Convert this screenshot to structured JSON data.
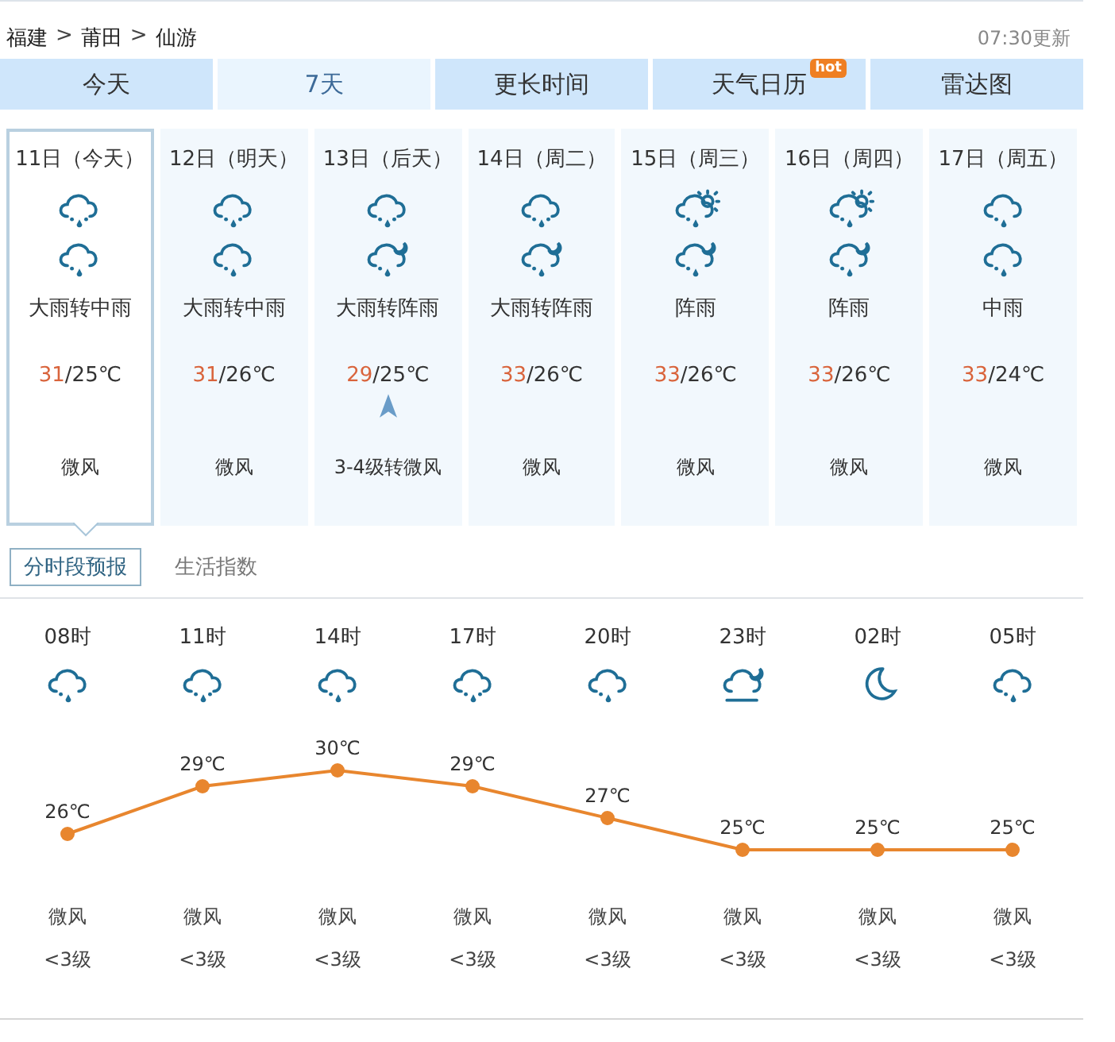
{
  "breadcrumb": [
    {
      "label": "福建"
    },
    {
      "label": "莆田"
    },
    {
      "label": "仙游"
    }
  ],
  "breadcrumb_separator": ">",
  "updated": "07:30更新",
  "tabs": [
    {
      "label": "今天",
      "selected": false
    },
    {
      "label": "7天",
      "selected": true
    },
    {
      "label": "更长时间",
      "selected": false
    },
    {
      "label": "天气日历",
      "selected": false,
      "badge": "hot"
    },
    {
      "label": "雷达图",
      "selected": false
    }
  ],
  "days": [
    {
      "date": "11日（今天）",
      "selected": true,
      "icons": [
        {
          "kind": "heavy-rain"
        },
        {
          "kind": "rain"
        }
      ],
      "weather": "大雨转中雨",
      "high": "31",
      "low": "/25℃",
      "wind_arrow": false,
      "wind": "微风"
    },
    {
      "date": "12日（明天）",
      "selected": false,
      "icons": [
        {
          "kind": "heavy-rain"
        },
        {
          "kind": "rain"
        }
      ],
      "weather": "大雨转中雨",
      "high": "31",
      "low": "/26℃",
      "wind_arrow": false,
      "wind": "微风"
    },
    {
      "date": "13日（后天）",
      "selected": false,
      "icons": [
        {
          "kind": "heavy-rain"
        },
        {
          "kind": "shower-night"
        }
      ],
      "weather": "大雨转阵雨",
      "high": "29",
      "low": "/25℃",
      "wind_arrow": true,
      "wind": "3-4级转微风"
    },
    {
      "date": "14日（周二）",
      "selected": false,
      "icons": [
        {
          "kind": "heavy-rain"
        },
        {
          "kind": "shower-night"
        }
      ],
      "weather": "大雨转阵雨",
      "high": "33",
      "low": "/26℃",
      "wind_arrow": false,
      "wind": "微风"
    },
    {
      "date": "15日（周三）",
      "selected": false,
      "icons": [
        {
          "kind": "shower-day"
        },
        {
          "kind": "shower-night"
        }
      ],
      "weather": "阵雨",
      "high": "33",
      "low": "/26℃",
      "wind_arrow": false,
      "wind": "微风"
    },
    {
      "date": "16日（周四）",
      "selected": false,
      "icons": [
        {
          "kind": "shower-day"
        },
        {
          "kind": "shower-night"
        }
      ],
      "weather": "阵雨",
      "high": "33",
      "low": "/26℃",
      "wind_arrow": false,
      "wind": "微风"
    },
    {
      "date": "17日（周五）",
      "selected": false,
      "icons": [
        {
          "kind": "rain"
        },
        {
          "kind": "rain"
        }
      ],
      "weather": "中雨",
      "high": "33",
      "low": "/24℃",
      "wind_arrow": false,
      "wind": "微风"
    }
  ],
  "subtabs": [
    {
      "label": "分时段预报",
      "selected": true
    },
    {
      "label": "生活指数",
      "selected": false
    }
  ],
  "hourly": [
    {
      "time": "08时",
      "kind": "rain",
      "wind": "微风",
      "level": "<3级"
    },
    {
      "time": "11时",
      "kind": "heavy-rain",
      "wind": "微风",
      "level": "<3级"
    },
    {
      "time": "14时",
      "kind": "rain",
      "wind": "微风",
      "level": "<3级"
    },
    {
      "time": "17时",
      "kind": "heavy-rain",
      "wind": "微风",
      "level": "<3级"
    },
    {
      "time": "20时",
      "kind": "rain",
      "wind": "微风",
      "level": "<3级"
    },
    {
      "time": "23时",
      "kind": "cloudy-night",
      "wind": "微风",
      "level": "<3级"
    },
    {
      "time": "02时",
      "kind": "moon",
      "wind": "微风",
      "level": "<3级"
    },
    {
      "time": "05时",
      "kind": "rain",
      "wind": "微风",
      "level": "<3级"
    }
  ],
  "chart_data": {
    "type": "line",
    "series": [
      {
        "color": "#e8862e",
        "marker": "circle",
        "values": [
          26,
          29,
          30,
          29,
          27,
          25,
          25,
          25
        ],
        "value_labels": [
          "26℃",
          "29℃",
          "30℃",
          "29℃",
          "27℃",
          "25℃",
          "25℃",
          "25℃"
        ]
      }
    ]
  }
}
